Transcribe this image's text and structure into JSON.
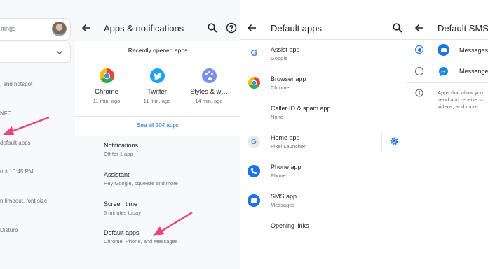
{
  "panel1": {
    "search_placeholder": "ttings",
    "items": [
      {
        "sub": ", and hotspot"
      },
      {
        "sub": "NFC"
      },
      {
        "sub": "default apps"
      },
      {
        "sub": "out 10:45 PM"
      },
      {
        "sub": "n timeout, font size"
      },
      {
        "sub": "Disturb"
      }
    ]
  },
  "panel2": {
    "title": "Apps & notifications",
    "recent_header": "Recently opened apps",
    "recent": [
      {
        "name": "Chrome",
        "time": "11 min. ago"
      },
      {
        "name": "Twitter",
        "time": "11 min. ago"
      },
      {
        "name": "Styles & w…",
        "time": "14 min. ago"
      }
    ],
    "see_all": "See all 204 apps",
    "items": [
      {
        "title": "Notifications",
        "sub": "Off for 1 app"
      },
      {
        "title": "Assistant",
        "sub": "Hey Google, squeeze and more"
      },
      {
        "title": "Screen time",
        "sub": "6 minutes today"
      },
      {
        "title": "Default apps",
        "sub": "Chrome, Phone, and Messages"
      }
    ]
  },
  "panel3": {
    "title": "Default apps",
    "items": [
      {
        "title": "Assist app",
        "sub": "Google"
      },
      {
        "title": "Browser app",
        "sub": "Chrome"
      },
      {
        "title": "Caller ID & spam app",
        "sub": "None"
      },
      {
        "title": "Home app",
        "sub": "Pixel Launcher"
      },
      {
        "title": "Phone app",
        "sub": "Phone"
      },
      {
        "title": "SMS app",
        "sub": "Messages"
      },
      {
        "title": "Opening links",
        "sub": ""
      }
    ]
  },
  "panel4": {
    "title": "Default SMS a",
    "options": [
      {
        "label": "Messages",
        "selected": true
      },
      {
        "label": "Messenge",
        "selected": false
      }
    ],
    "info": [
      "Apps that allow you",
      "send and receive sh",
      "videos, and more"
    ]
  },
  "colors": {
    "accent": "#1a73e8",
    "arrow": "#e8457a",
    "divider": "#e3e5e8"
  }
}
